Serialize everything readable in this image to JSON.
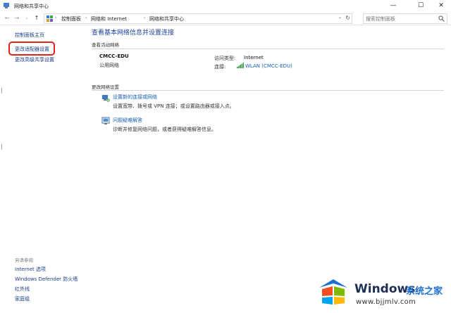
{
  "window": {
    "title": "网络和共享中心",
    "controls": {
      "minimize": "—",
      "maximize": "☐",
      "close": "✕"
    }
  },
  "address": {
    "breadcrumbs": [
      "控制面板",
      "网络和 Internet",
      "网络和共享中心"
    ],
    "search_placeholder": "搜索控制面板"
  },
  "left_pane": {
    "links": [
      "控制面板主页",
      "更改适配器设置",
      "更改高级共享设置"
    ],
    "see_also_label": "另请参阅",
    "see_also_links": [
      "Internet 选项",
      "Windows Defender 防火墙",
      "红外线",
      "家庭组"
    ]
  },
  "main": {
    "heading": "查看基本网络信息并设置连接",
    "active_networks_label": "查看活动网络",
    "network": {
      "name": "CMCC-EDU",
      "type": "公用网络",
      "access_type_label": "访问类型:",
      "access_type_value": "Internet",
      "connection_label": "连接:",
      "connection_value": "WLAN (CMCC-EDU)"
    },
    "change_settings_label": "更改网络设置",
    "tasks": [
      {
        "title": "设置新的连接或网络",
        "description": "设置宽带、拨号或 VPN 连接；或设置路由器或接入点。",
        "icon": "network-setup-icon"
      },
      {
        "title": "问题疑难解答",
        "description": "诊断并修复网络问题，或者获得疑难解答信息。",
        "icon": "troubleshoot-icon"
      }
    ]
  },
  "watermark": {
    "brand": "Windows",
    "brand_cn": "系统之家",
    "url": "www.bjjmlv.com"
  },
  "colors": {
    "link": "#1a5fb4",
    "heading": "#1f3f9c",
    "highlight": "#e2231a"
  }
}
